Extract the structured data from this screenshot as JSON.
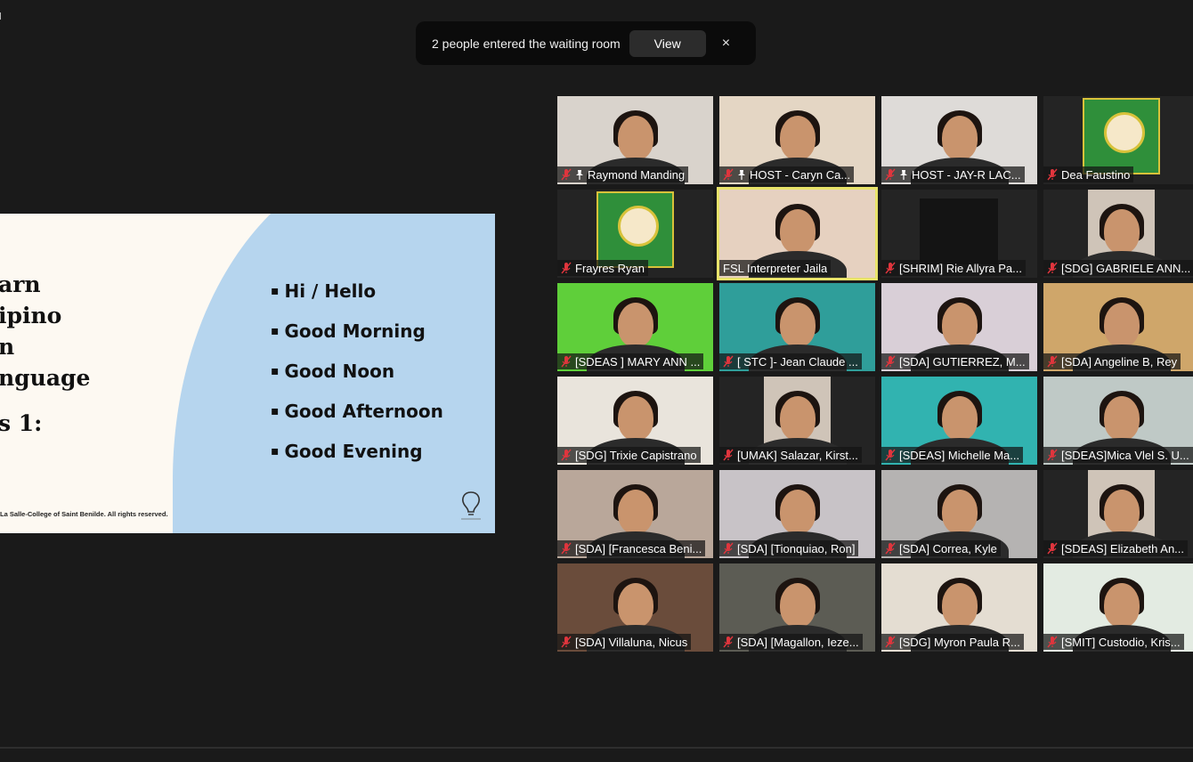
{
  "notification": {
    "text": "2 people entered the waiting room",
    "view_label": "View",
    "close_glyph": "×"
  },
  "slide": {
    "title_lines": [
      "arn",
      "ipino",
      "n",
      "nguage"
    ],
    "lesson": "s 1:",
    "items": [
      "Hi / Hello",
      "Good Morning",
      "Good Noon",
      "Good Afternoon",
      "Good Evening"
    ],
    "footer": "La Salle-College of Saint Benilde. All rights reserved.",
    "logo_icon": "lightbulb-logo-icon",
    "colors": {
      "panel": "#b6d5ee",
      "background": "#fdf9f2"
    }
  },
  "participants": [
    {
      "name": "Raymond Manding",
      "muted": true,
      "pinned": true,
      "bg": "#d9d3cc"
    },
    {
      "name": "HOST - Caryn Ca...",
      "muted": true,
      "pinned": true,
      "bg": "#e4d6c4"
    },
    {
      "name": "HOST -  JAY-R LAC...",
      "muted": true,
      "pinned": true,
      "bg": "#dedbd8"
    },
    {
      "name": "Dea Faustino",
      "muted": true,
      "pinned": false,
      "bg": "#242424",
      "poster": true
    },
    {
      "name": "Frayres Ryan",
      "muted": true,
      "pinned": false,
      "bg": "#242424",
      "poster": true
    },
    {
      "name": "FSL Interpreter Jaila",
      "muted": false,
      "pinned": false,
      "bg": "#e6d1c0",
      "active": true
    },
    {
      "name": "[SHRIM] Rie Allyra Pa...",
      "muted": true,
      "pinned": false,
      "bg": "#242424",
      "dark": true
    },
    {
      "name": "[SDG] GABRIELE ANN...",
      "muted": true,
      "pinned": false,
      "bg": "#242424",
      "center": true
    },
    {
      "name": "[SDEAS ] MARY ANN ...",
      "muted": true,
      "pinned": false,
      "bg": "#5fcf3a"
    },
    {
      "name": "[ STC ]- Jean Claude ...",
      "muted": true,
      "pinned": false,
      "bg": "#2f9e9a"
    },
    {
      "name": "[SDA] GUTIERREZ, M...",
      "muted": true,
      "pinned": false,
      "bg": "#d9cfd7"
    },
    {
      "name": "[SDA] Angeline B, Rey",
      "muted": true,
      "pinned": false,
      "bg": "#cfa66a"
    },
    {
      "name": "[SDG] Trixie Capistrano",
      "muted": true,
      "pinned": false,
      "bg": "#e9e4dc"
    },
    {
      "name": "[UMAK] Salazar, Kirst...",
      "muted": true,
      "pinned": false,
      "bg": "#242424",
      "center": true
    },
    {
      "name": "[SDEAS] Michelle Ma...",
      "muted": true,
      "pinned": false,
      "bg": "#31b3b0"
    },
    {
      "name": "[SDEAS]Mica Vlel S. U...",
      "muted": true,
      "pinned": false,
      "bg": "#bfc9c6"
    },
    {
      "name": "[SDA] [Francesca Beni...",
      "muted": true,
      "pinned": false,
      "bg": "#b9a79a"
    },
    {
      "name": "[SDA] [Tionquiao, Ron]",
      "muted": true,
      "pinned": false,
      "bg": "#c8c3c7"
    },
    {
      "name": "[SDA] Correa, Kyle",
      "muted": true,
      "pinned": false,
      "bg": "#b5b3b2"
    },
    {
      "name": "[SDEAS] Elizabeth An...",
      "muted": true,
      "pinned": false,
      "bg": "#242424",
      "center": true
    },
    {
      "name": "[SDA] Villaluna, Nicus",
      "muted": true,
      "pinned": false,
      "bg": "#6a4c3b"
    },
    {
      "name": "[SDA] [Magallon, Ieze...",
      "muted": true,
      "pinned": false,
      "bg": "#5c5c54"
    },
    {
      "name": "[SDG] Myron Paula R...",
      "muted": true,
      "pinned": false,
      "bg": "#e4ddd2"
    },
    {
      "name": "[SMIT] Custodio, Kris...",
      "muted": true,
      "pinned": false,
      "bg": "#e3ebe2"
    }
  ],
  "icons": {
    "mute": "mic-muted-icon",
    "pin": "pin-icon"
  },
  "colors": {
    "app_bg": "#1a1a1a",
    "active_speaker": "#e8e36a",
    "mute_red": "#e0353d"
  }
}
